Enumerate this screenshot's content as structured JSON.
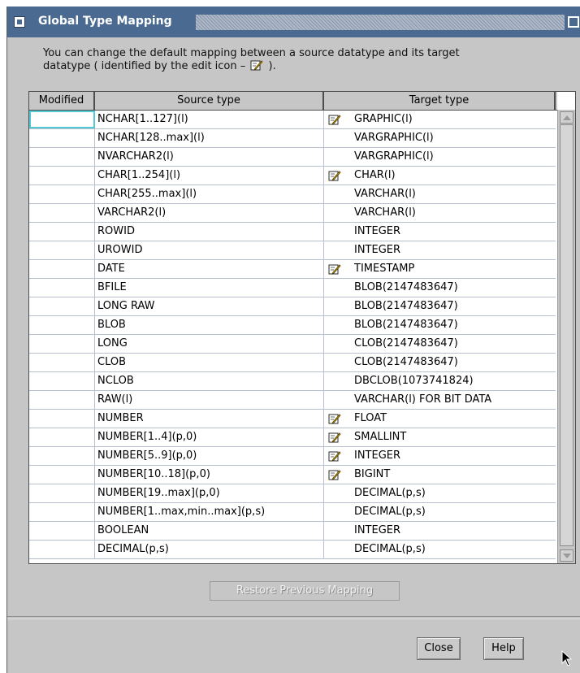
{
  "window": {
    "title": "Global Type Mapping"
  },
  "description": {
    "line1": "You can change the default mapping between a source datatype and its target",
    "line2_prefix": "datatype ( identified by the edit icon –",
    "line2_suffix": ")."
  },
  "table": {
    "headers": {
      "modified": "Modified",
      "source": "Source type",
      "target": "Target type"
    },
    "rows": [
      {
        "source": "NCHAR[1..127](l)",
        "target": "GRAPHIC(l)",
        "edited": true
      },
      {
        "source": "NCHAR[128..max](l)",
        "target": "VARGRAPHIC(l)",
        "edited": false
      },
      {
        "source": "NVARCHAR2(l)",
        "target": "VARGRAPHIC(l)",
        "edited": false
      },
      {
        "source": "CHAR[1..254](l)",
        "target": "CHAR(l)",
        "edited": true
      },
      {
        "source": "CHAR[255..max](l)",
        "target": "VARCHAR(l)",
        "edited": false
      },
      {
        "source": "VARCHAR2(l)",
        "target": "VARCHAR(l)",
        "edited": false
      },
      {
        "source": "ROWID",
        "target": "INTEGER",
        "edited": false
      },
      {
        "source": "UROWID",
        "target": "INTEGER",
        "edited": false
      },
      {
        "source": "DATE",
        "target": "TIMESTAMP",
        "edited": true
      },
      {
        "source": "BFILE",
        "target": "BLOB(2147483647)",
        "edited": false
      },
      {
        "source": "LONG RAW",
        "target": "BLOB(2147483647)",
        "edited": false
      },
      {
        "source": "BLOB",
        "target": "BLOB(2147483647)",
        "edited": false
      },
      {
        "source": "LONG",
        "target": "CLOB(2147483647)",
        "edited": false
      },
      {
        "source": "CLOB",
        "target": "CLOB(2147483647)",
        "edited": false
      },
      {
        "source": "NCLOB",
        "target": "DBCLOB(1073741824)",
        "edited": false
      },
      {
        "source": "RAW(l)",
        "target": "VARCHAR(l) FOR BIT DATA",
        "edited": false
      },
      {
        "source": "NUMBER",
        "target": "FLOAT",
        "edited": true
      },
      {
        "source": "NUMBER[1..4](p,0)",
        "target": "SMALLINT",
        "edited": true
      },
      {
        "source": "NUMBER[5..9](p,0)",
        "target": "INTEGER",
        "edited": true
      },
      {
        "source": "NUMBER[10..18](p,0)",
        "target": "BIGINT",
        "edited": true
      },
      {
        "source": "NUMBER[19..max](p,0)",
        "target": "DECIMAL(p,s)",
        "edited": false
      },
      {
        "source": "NUMBER[1..max,min..max](p,s)",
        "target": "DECIMAL(p,s)",
        "edited": false
      },
      {
        "source": "BOOLEAN",
        "target": "INTEGER",
        "edited": false
      },
      {
        "source": "DECIMAL(p,s)",
        "target": "DECIMAL(p,s)",
        "edited": false
      }
    ]
  },
  "buttons": {
    "restore": "Restore Previous Mapping",
    "close": "Close",
    "help": "Help"
  },
  "icons": {
    "edit": "edit-pencil-icon",
    "system_menu": "system-menu-icon",
    "maximize": "maximize-icon",
    "cursor": "mouse-pointer-icon"
  },
  "colors": {
    "titlebar": "#4a6a92",
    "dialog_bg": "#c6c6c6",
    "selection_outline": "#54c8d4"
  }
}
